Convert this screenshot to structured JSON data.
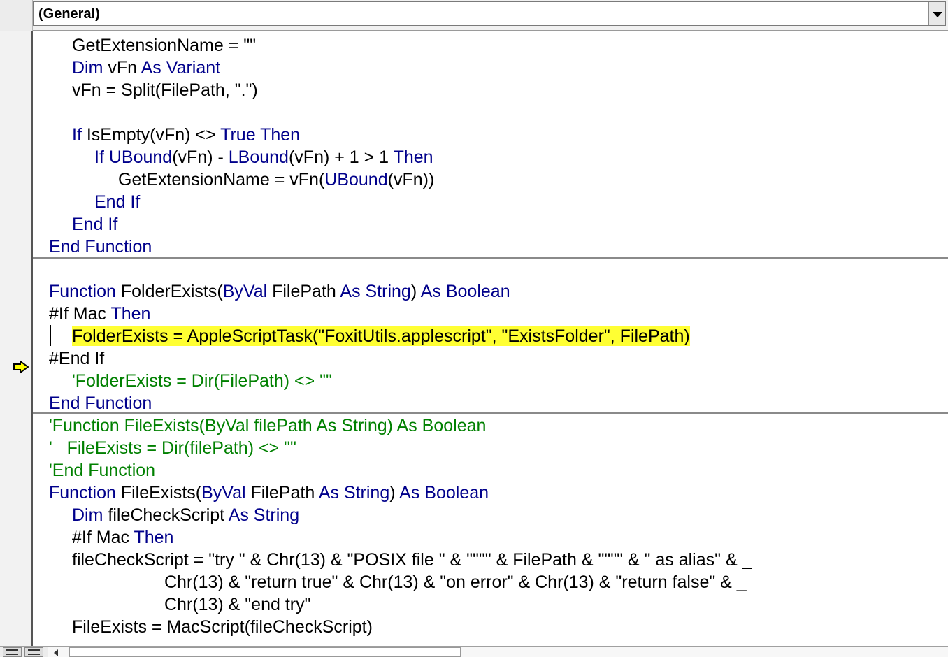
{
  "procedure_dropdown": {
    "value": "(General)"
  },
  "colors": {
    "keyword": "#00008b",
    "comment": "#008000",
    "highlight": "#ffff33",
    "arrow": "#ffff00"
  },
  "icons": {
    "execution_pointer": "yellow-arrow-right",
    "procedure_view": "lines-icon",
    "module_view": "lines-icon"
  },
  "code": {
    "l1_a": "GetExtensionName = \"\"",
    "l2_a": "Dim",
    "l2_b": " vFn ",
    "l2_c": "As Variant",
    "l3_a": "vFn = Split(FilePath, \".\")",
    "l5_a": "If",
    "l5_b": " IsEmpty(vFn) <> ",
    "l5_c": "True Then",
    "l6_a": "If",
    "l6_b": " ",
    "l6_c": "UBound",
    "l6_d": "(vFn) - ",
    "l6_e": "LBound",
    "l6_f": "(vFn) + 1 > 1 ",
    "l6_g": "Then",
    "l7_a": "GetExtensionName = vFn(",
    "l7_b": "UBound",
    "l7_c": "(vFn))",
    "l8_a": "End If",
    "l9_a": "End If",
    "l10_a": "End Function",
    "l12_a": "Function",
    "l12_b": " FolderExists(",
    "l12_c": "ByVal",
    "l12_d": " FilePath ",
    "l12_e": "As String",
    "l12_f": ") ",
    "l12_g": "As Boolean",
    "l13_a": "#If",
    "l13_b": " Mac ",
    "l13_c": "Then",
    "l14_a": "FolderExists = AppleScriptTask(\"FoxitUtils.applescript\", \"ExistsFolder\", FilePath)",
    "l15_a": "#End If",
    "l16_a": "'FolderExists = Dir(FilePath) <> \"\"",
    "l17_a": "End Function",
    "l18_a": "'Function FileExists(ByVal filePath As String) As Boolean",
    "l19_a": "'   FileExists = Dir(filePath) <> \"\"",
    "l20_a": "'End Function",
    "l21_a": "Function",
    "l21_b": " FileExists(",
    "l21_c": "ByVal",
    "l21_d": " FilePath ",
    "l21_e": "As String",
    "l21_f": ") ",
    "l21_g": "As Boolean",
    "l22_a": "Dim",
    "l22_b": " fileCheckScript ",
    "l22_c": "As String",
    "l23_a": "#If",
    "l23_b": " Mac ",
    "l23_c": "Then",
    "l24_a": "fileCheckScript = \"try \" & Chr(13) & \"POSIX file \" & \"\"\"\" & FilePath & \"\"\"\" & \" as alias\" & _",
    "l25_a": "Chr(13) & \"return true\" & Chr(13) & \"on error\" & Chr(13) & \"return false\" & _",
    "l26_a": "Chr(13) & \"end try\"",
    "l27_a": "FileExists = MacScript(fileCheckScript)"
  }
}
